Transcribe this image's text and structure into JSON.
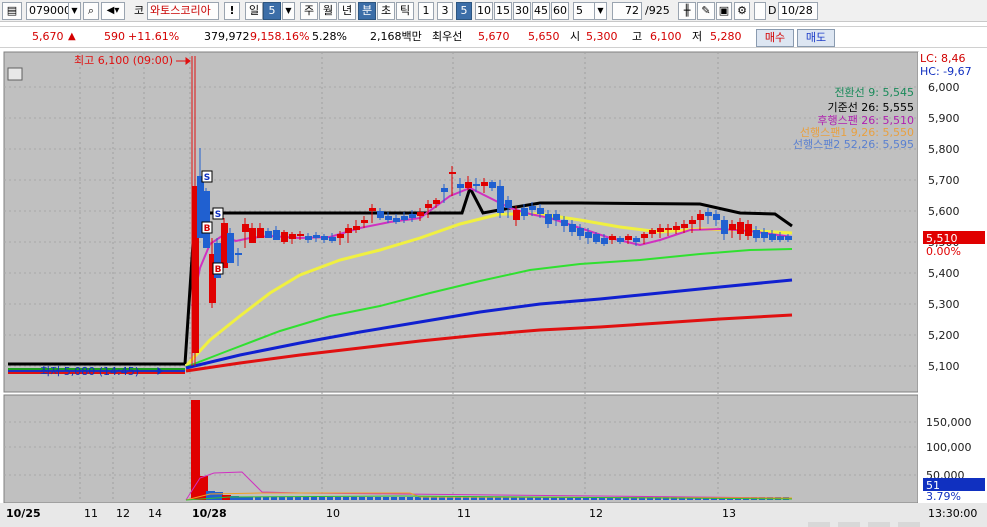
{
  "toolbar": {
    "code": "079000",
    "market": "코",
    "name": "와토스코리아",
    "warn": "!",
    "period_day": "일",
    "period_num": "5",
    "week": "주",
    "month": "월",
    "year": "년",
    "minute": "분",
    "second": "초",
    "tick": "틱",
    "intervals": [
      "1",
      "3",
      "5",
      "10",
      "15",
      "30",
      "45",
      "60"
    ],
    "interval_selected": "5",
    "count": "5",
    "page": "72",
    "page_total": "/925",
    "d_label": "D",
    "date": "10/28"
  },
  "quote": {
    "price": "5,670",
    "change": "590",
    "change_rate": "+11.61%",
    "volume": "379,972",
    "volume_rate": "9,158.16%",
    "turnover_rate": "5.28%",
    "amount": "2,168백만",
    "priority_label": "최우선",
    "ask": "5,670",
    "bid": "5,650",
    "open_label": "시",
    "open": "5,300",
    "high_label": "고",
    "high": "6,100",
    "low_label": "저",
    "low": "5,280",
    "buy_label": "매수",
    "sell_label": "매도"
  },
  "chart": {
    "high_marker": "최고 6,100 (09:00)",
    "low_marker": "최저 5,080 (14:45)",
    "lc": "LC: 8,46",
    "hc": "HC: -9,67",
    "price_ticks": [
      "6,000",
      "5,900",
      "5,800",
      "5,700",
      "5,600",
      "5,500",
      "5,400",
      "5,300",
      "5,200",
      "5,100"
    ],
    "current_price": "5,510",
    "current_rate": "0.00%",
    "volume_ticks": [
      "150,000",
      "100,000",
      "50,000"
    ],
    "current_volume": "51",
    "current_volume_rate": "3.79%",
    "legend": [
      {
        "text": "전환선 9: 5,545",
        "color": "#1a8a5a"
      },
      {
        "text": "기준선 26: 5,555",
        "color": "#000000"
      },
      {
        "text": "후행스팬 26: 5,510",
        "color": "#b020b0"
      },
      {
        "text": "선행스팬1 9,26: 5,550",
        "color": "#e8a040"
      },
      {
        "text": "선행스팬2 52,26: 5,595",
        "color": "#5a80d0"
      }
    ],
    "x_labels": [
      "10/25",
      "11",
      "12",
      "14",
      "10/28",
      "10",
      "11",
      "12",
      "13"
    ],
    "time_label": "13:30:00",
    "colors": {
      "up": "#e00000",
      "down": "#2060d0",
      "background": "#c0c0c0"
    }
  }
}
